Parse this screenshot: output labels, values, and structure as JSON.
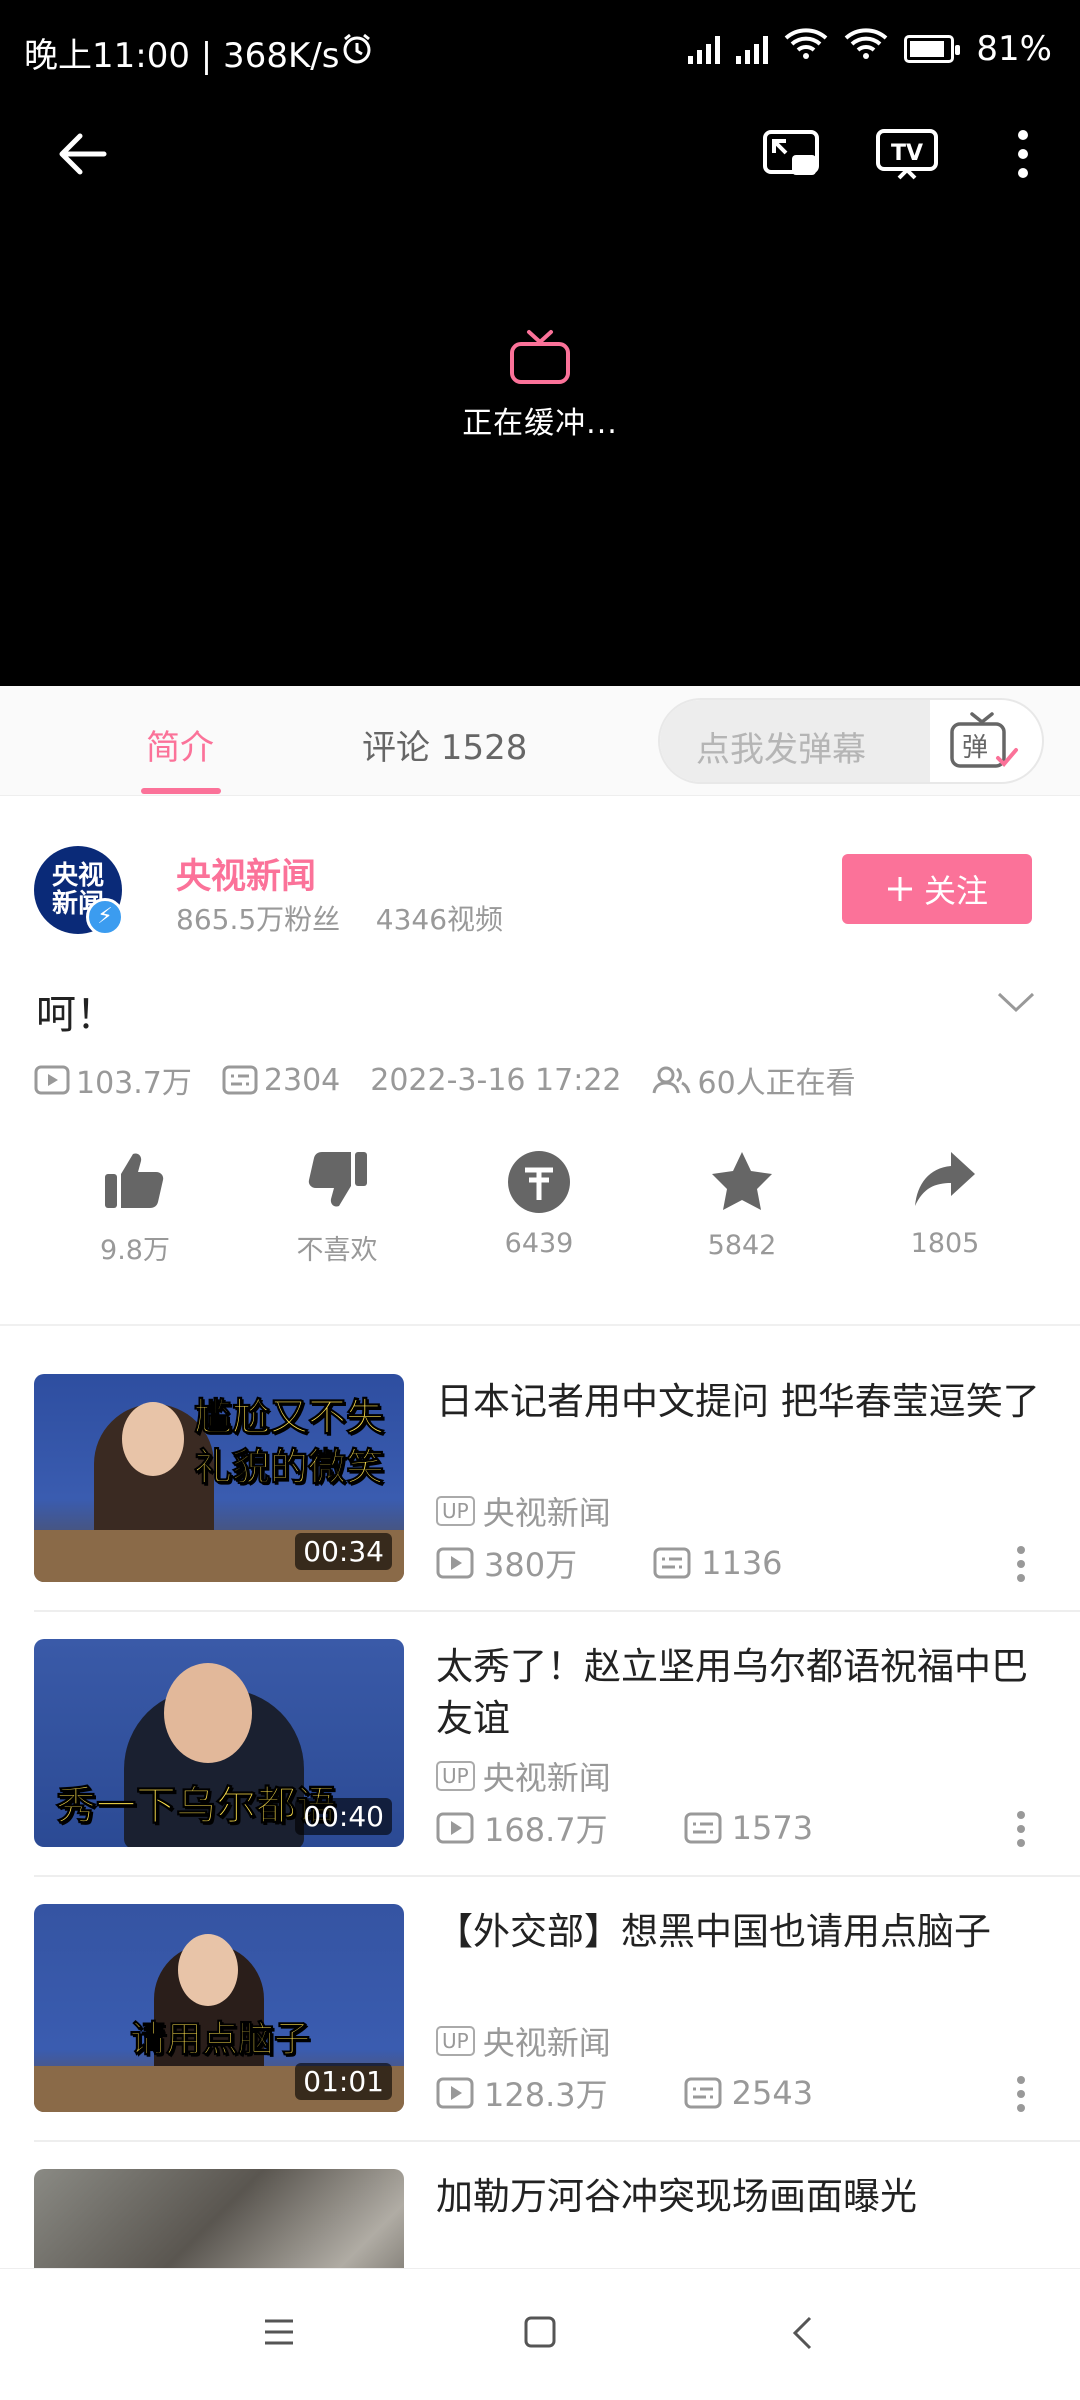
{
  "status_bar": {
    "time_speed": "晚上11:00 | 368K/s",
    "battery": "81%",
    "battery_level": 0.81
  },
  "player": {
    "buffering_text": "正在缓冲..."
  },
  "tabs": {
    "intro": "简介",
    "comments": "评论 1528",
    "danmaku_placeholder": "点我发弹幕",
    "danmaku_button": "弹"
  },
  "uploader": {
    "avatar_text": "央视新闻",
    "name": "央视新闻",
    "stats": "865.5万粉丝    4346视频",
    "follow_label": "关注"
  },
  "video": {
    "title": "呵！",
    "views": "103.7万",
    "danmaku_count": "2304",
    "date": "2022-3-16 17:22",
    "watching": "60人正在看"
  },
  "actions": [
    {
      "icon": "thumbs-up-icon",
      "label": "9.8万"
    },
    {
      "icon": "thumbs-down-icon",
      "label": "不喜欢"
    },
    {
      "icon": "coin-icon",
      "label": "6439"
    },
    {
      "icon": "star-icon",
      "label": "5842"
    },
    {
      "icon": "share-icon",
      "label": "1805"
    }
  ],
  "related": [
    {
      "title": "日本记者用中文提问 把华春莹逗笑了",
      "uploader": "央视新闻",
      "views": "380万",
      "danmaku": "1136",
      "duration": "00:34",
      "caption": "尴尬又不失礼貌的微笑",
      "upTag": "UP"
    },
    {
      "title": "太秀了！赵立坚用乌尔都语祝福中巴友谊",
      "uploader": "央视新闻",
      "views": "168.7万",
      "danmaku": "1573",
      "duration": "00:40",
      "caption": "秀一下乌尔都语",
      "upTag": "UP"
    },
    {
      "title": "【外交部】想黑中国也请用点脑子",
      "uploader": "央视新闻",
      "views": "128.3万",
      "danmaku": "2543",
      "duration": "01:01",
      "caption": "请用点脑子",
      "upTag": "UP"
    },
    {
      "title": "加勒万河谷冲突现场画面曝光"
    }
  ],
  "colors": {
    "accent": "#fb7299",
    "text_secondary": "#999999"
  }
}
